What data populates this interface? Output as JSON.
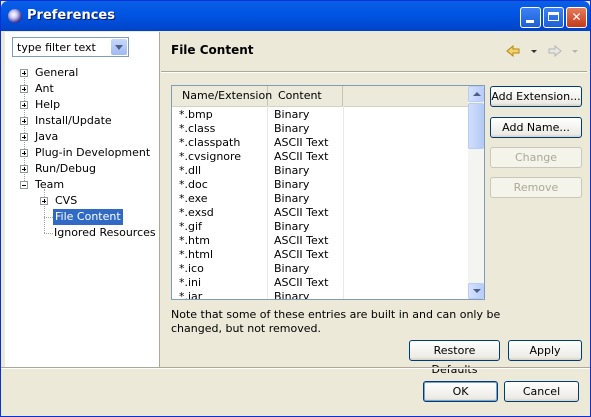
{
  "window": {
    "title": "Preferences"
  },
  "filter": {
    "text": "type filter text"
  },
  "tree": [
    {
      "label": "General",
      "expander": "plus"
    },
    {
      "label": "Ant",
      "expander": "plus"
    },
    {
      "label": "Help",
      "expander": "plus"
    },
    {
      "label": "Install/Update",
      "expander": "plus"
    },
    {
      "label": "Java",
      "expander": "plus"
    },
    {
      "label": "Plug-in Development",
      "expander": "plus"
    },
    {
      "label": "Run/Debug",
      "expander": "plus"
    },
    {
      "label": "Team",
      "expander": "minus"
    }
  ],
  "team_children": [
    {
      "label": "CVS",
      "expander": "plus"
    },
    {
      "label": "File Content",
      "selected": true
    },
    {
      "label": "Ignored Resources"
    }
  ],
  "page": {
    "title": "File Content",
    "back_icon": "arrow-left-icon",
    "forward_icon": "arrow-right-icon"
  },
  "table": {
    "columns": [
      "Name/Extension",
      "Content"
    ],
    "rows": [
      [
        "*.bmp",
        "Binary"
      ],
      [
        "*.class",
        "Binary"
      ],
      [
        "*.classpath",
        "ASCII Text"
      ],
      [
        "*.cvsignore",
        "ASCII Text"
      ],
      [
        "*.dll",
        "Binary"
      ],
      [
        "*.doc",
        "Binary"
      ],
      [
        "*.exe",
        "Binary"
      ],
      [
        "*.exsd",
        "ASCII Text"
      ],
      [
        "*.gif",
        "Binary"
      ],
      [
        "*.htm",
        "ASCII Text"
      ],
      [
        "*.html",
        "ASCII Text"
      ],
      [
        "*.ico",
        "Binary"
      ],
      [
        "*.ini",
        "ASCII Text"
      ],
      [
        "*.jar",
        "Binary"
      ]
    ]
  },
  "side_buttons": {
    "add_extension": "Add Extension...",
    "add_name": "Add Name...",
    "change": "Change",
    "remove": "Remove"
  },
  "note": "Note that some of these entries are built in and can only be changed, but not removed.",
  "bottom_buttons": {
    "restore_defaults": "Restore Defaults",
    "apply": "Apply",
    "ok": "OK",
    "cancel": "Cancel"
  },
  "colors": {
    "title_bar": "#0054e3",
    "selection": "#316ac5",
    "dialog_bg": "#ece9d8"
  }
}
